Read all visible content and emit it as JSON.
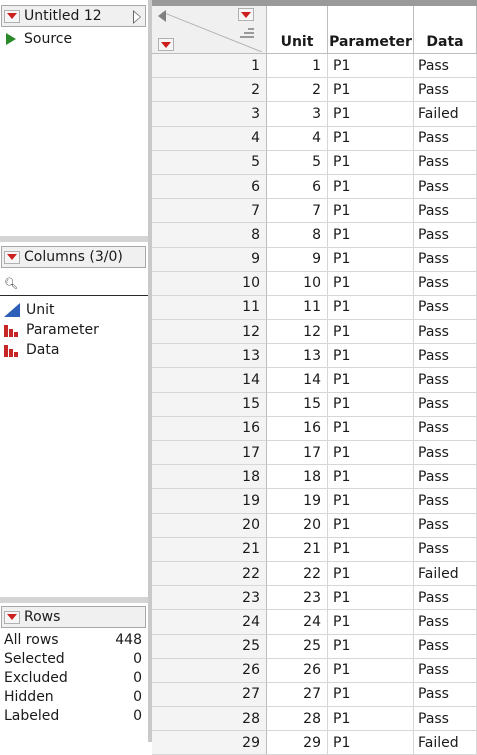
{
  "table_panel": {
    "title": "Untitled 12",
    "source_label": "Source"
  },
  "columns_panel": {
    "header": "Columns (3/0)",
    "search_placeholder": "",
    "items": [
      {
        "label": "Unit",
        "icon": "continuous-icon"
      },
      {
        "label": "Parameter",
        "icon": "nominal-icon"
      },
      {
        "label": "Data",
        "icon": "nominal-icon"
      }
    ]
  },
  "rows_panel": {
    "header": "Rows",
    "stats": [
      {
        "label": "All rows",
        "value": "448"
      },
      {
        "label": "Selected",
        "value": "0"
      },
      {
        "label": "Excluded",
        "value": "0"
      },
      {
        "label": "Hidden",
        "value": "0"
      },
      {
        "label": "Labeled",
        "value": "0"
      }
    ]
  },
  "grid": {
    "headers": [
      "Unit",
      "Parameter",
      "Data"
    ],
    "rows": [
      {
        "n": "1",
        "unit": "1",
        "param": "P1",
        "data": "Pass"
      },
      {
        "n": "2",
        "unit": "2",
        "param": "P1",
        "data": "Pass"
      },
      {
        "n": "3",
        "unit": "3",
        "param": "P1",
        "data": "Failed"
      },
      {
        "n": "4",
        "unit": "4",
        "param": "P1",
        "data": "Pass"
      },
      {
        "n": "5",
        "unit": "5",
        "param": "P1",
        "data": "Pass"
      },
      {
        "n": "6",
        "unit": "6",
        "param": "P1",
        "data": "Pass"
      },
      {
        "n": "7",
        "unit": "7",
        "param": "P1",
        "data": "Pass"
      },
      {
        "n": "8",
        "unit": "8",
        "param": "P1",
        "data": "Pass"
      },
      {
        "n": "9",
        "unit": "9",
        "param": "P1",
        "data": "Pass"
      },
      {
        "n": "10",
        "unit": "10",
        "param": "P1",
        "data": "Pass"
      },
      {
        "n": "11",
        "unit": "11",
        "param": "P1",
        "data": "Pass"
      },
      {
        "n": "12",
        "unit": "12",
        "param": "P1",
        "data": "Pass"
      },
      {
        "n": "13",
        "unit": "13",
        "param": "P1",
        "data": "Pass"
      },
      {
        "n": "14",
        "unit": "14",
        "param": "P1",
        "data": "Pass"
      },
      {
        "n": "15",
        "unit": "15",
        "param": "P1",
        "data": "Pass"
      },
      {
        "n": "16",
        "unit": "16",
        "param": "P1",
        "data": "Pass"
      },
      {
        "n": "17",
        "unit": "17",
        "param": "P1",
        "data": "Pass"
      },
      {
        "n": "18",
        "unit": "18",
        "param": "P1",
        "data": "Pass"
      },
      {
        "n": "19",
        "unit": "19",
        "param": "P1",
        "data": "Pass"
      },
      {
        "n": "20",
        "unit": "20",
        "param": "P1",
        "data": "Pass"
      },
      {
        "n": "21",
        "unit": "21",
        "param": "P1",
        "data": "Pass"
      },
      {
        "n": "22",
        "unit": "22",
        "param": "P1",
        "data": "Failed"
      },
      {
        "n": "23",
        "unit": "23",
        "param": "P1",
        "data": "Pass"
      },
      {
        "n": "24",
        "unit": "24",
        "param": "P1",
        "data": "Pass"
      },
      {
        "n": "25",
        "unit": "25",
        "param": "P1",
        "data": "Pass"
      },
      {
        "n": "26",
        "unit": "26",
        "param": "P1",
        "data": "Pass"
      },
      {
        "n": "27",
        "unit": "27",
        "param": "P1",
        "data": "Pass"
      },
      {
        "n": "28",
        "unit": "28",
        "param": "P1",
        "data": "Pass"
      },
      {
        "n": "29",
        "unit": "29",
        "param": "P1",
        "data": "Failed"
      }
    ]
  },
  "colors": {
    "red_triangle": "#cc1f1f",
    "continuous_icon": "#2e5fb8",
    "nominal_icon": "#c62626",
    "source_icon": "#2a8a2a"
  }
}
